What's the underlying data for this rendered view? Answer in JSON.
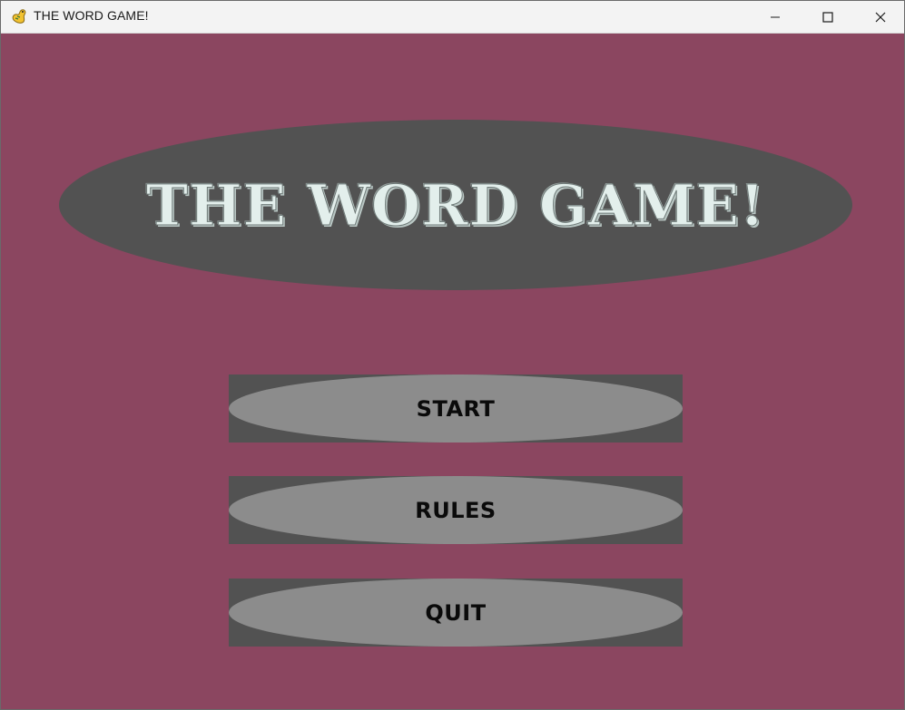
{
  "window": {
    "title": "THE WORD GAME!",
    "controls": [
      "minimize",
      "maximize",
      "close"
    ]
  },
  "game": {
    "heading": "THE WORD GAME!",
    "menu": {
      "start_label": "START",
      "rules_label": "RULES",
      "quit_label": "QUIT"
    }
  },
  "icons": {
    "app": "pygame-snake-icon",
    "minimize": "minimize-icon",
    "maximize": "maximize-icon",
    "close": "close-icon"
  },
  "colors": {
    "background": "#8b4660",
    "title_oval": "#525252",
    "title_text": "#e3efec",
    "button_frame": "#525252",
    "button_oval": "#8c8c8c",
    "button_text": "#0a0a0a"
  }
}
